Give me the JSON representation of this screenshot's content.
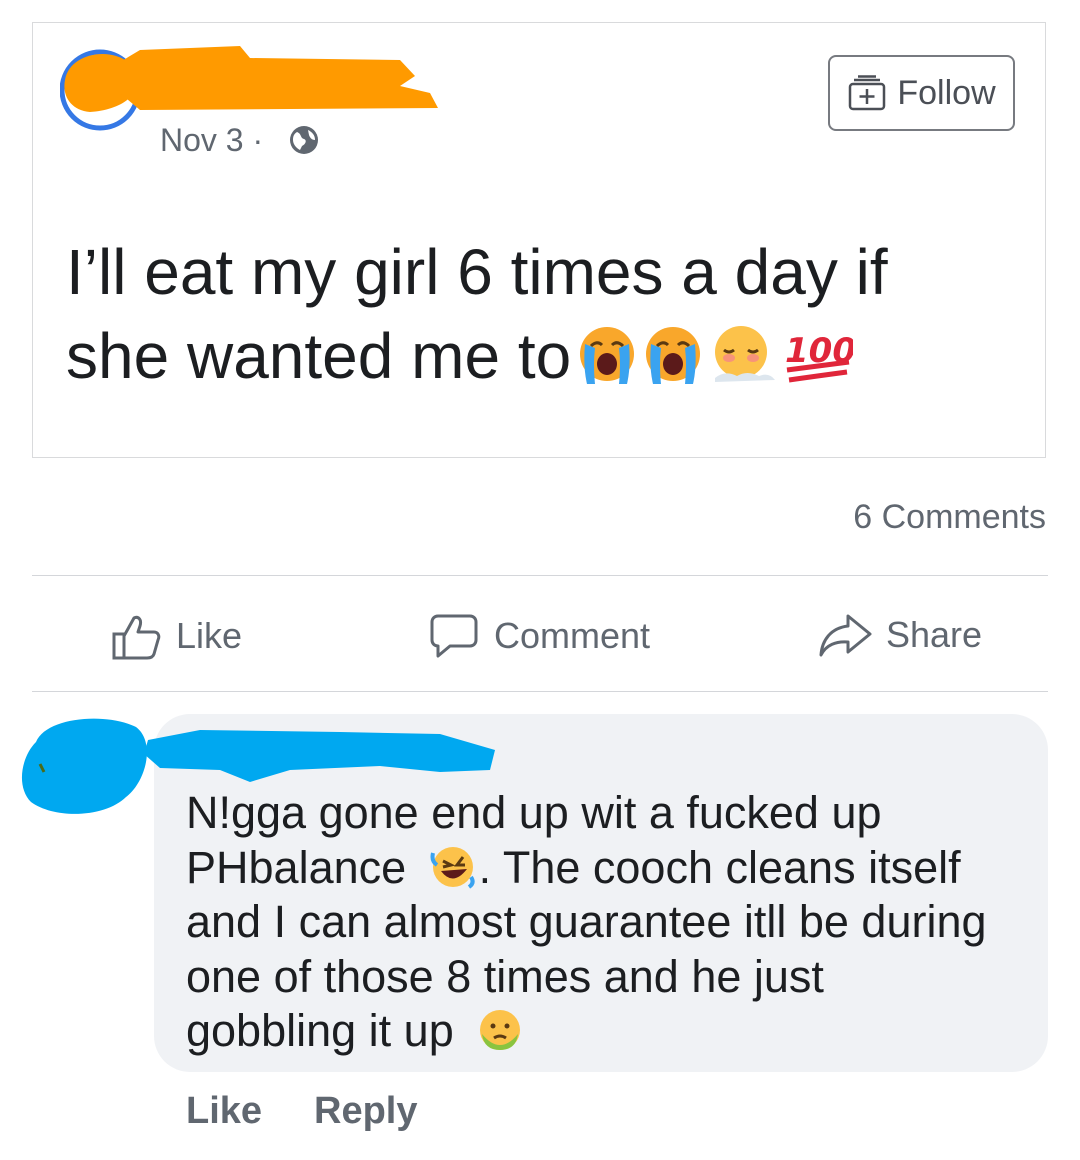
{
  "post": {
    "date": "Nov 3 ·",
    "follow_label": "Follow",
    "text": "I’ll eat my girl  6 times a day if she wanted me to",
    "emojis": [
      "crying-face-emoji",
      "crying-face-emoji",
      "relieved-face-emoji",
      "hundred-points-emoji"
    ]
  },
  "stats": {
    "comments": "6 Comments"
  },
  "actions": {
    "like": "Like",
    "comment": "Comment",
    "share": "Share"
  },
  "comment": {
    "text_1": "N!gga gone end up wit a fucked up",
    "text_2a": "PHbalance",
    "text_2b": ". The cooch cleans itself",
    "text_3": "and I can almost guarantee itll be during",
    "text_4": "one of those 8 times and he just",
    "text_5": "gobbling it up",
    "like_label": "Like",
    "reply_label": "Reply"
  },
  "colors": {
    "scribble_orange": "#ff9a00",
    "scribble_blue": "#00a8f0",
    "bubble": "#f0f2f5"
  }
}
